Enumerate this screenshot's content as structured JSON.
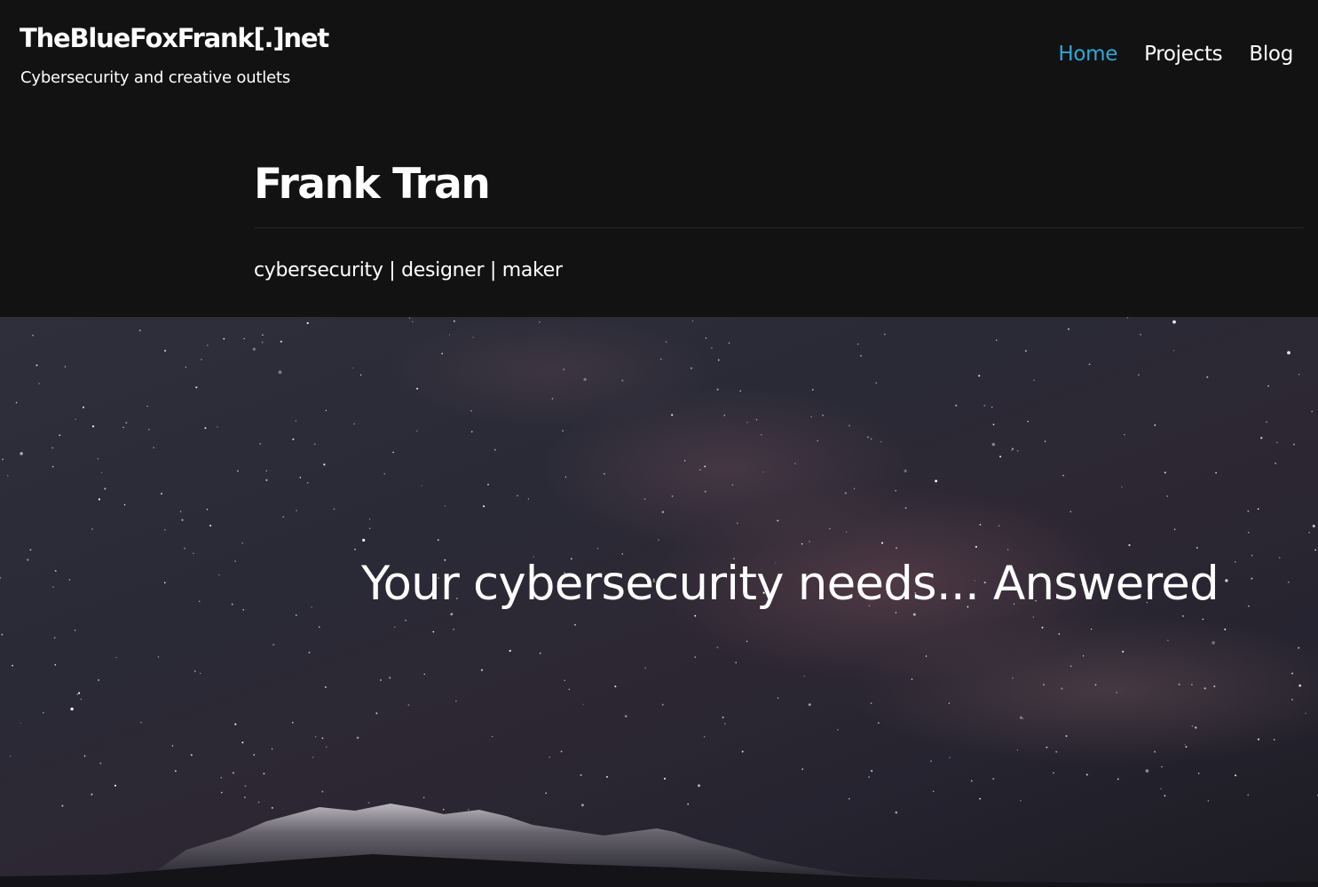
{
  "header": {
    "site_title": "TheBlueFoxFrank[.]net",
    "site_tagline": "Cybersecurity and creative outlets"
  },
  "nav": {
    "items": [
      {
        "label": "Home",
        "active": true
      },
      {
        "label": "Projects",
        "active": false
      },
      {
        "label": "Blog",
        "active": false
      }
    ]
  },
  "hero": {
    "name": "Frank Tran",
    "roles": "cybersecurity | designer | maker"
  },
  "banner": {
    "headline": "Your cybersecurity needs... Answered",
    "image": "starry-sky-milky-way-mountains"
  },
  "colors": {
    "background": "#121212",
    "accent": "#2ea8d8",
    "text": "#ffffff"
  }
}
